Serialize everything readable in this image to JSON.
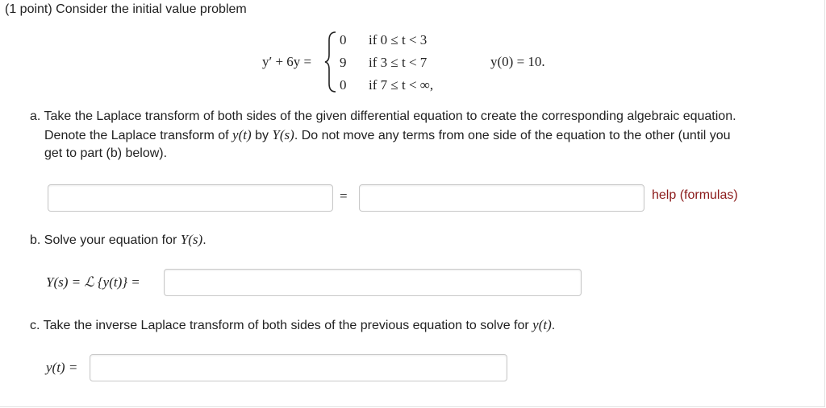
{
  "header": {
    "points": "(1 point)",
    "intro": "Consider the initial value problem"
  },
  "equation": {
    "lhs": "y′ + 6y =",
    "cases": [
      {
        "value": "0",
        "condition": "if 0 ≤ t < 3"
      },
      {
        "value": "9",
        "condition": "if 3 ≤ t < 7"
      },
      {
        "value": "0",
        "condition": "if 7 ≤ t < ∞,"
      }
    ],
    "initial_condition": "y(0) = 10."
  },
  "part_a": {
    "line1": "a. Take the Laplace transform of both sides of the given differential equation to create the corresponding algebraic equation.",
    "line2_pre": "Denote the Laplace transform of ",
    "line2_y": "y(t)",
    "line2_mid": " by ",
    "line2_Y": "Y(s)",
    "line2_post": ". Do not move any terms from one side of the equation to the other (until you",
    "line3": "get to part (b) below).",
    "equals": "=",
    "lhs_value": "",
    "rhs_value": "",
    "help_label": "help (formulas)"
  },
  "part_b": {
    "prompt_pre": "b. Solve your equation for ",
    "prompt_math": "Y(s)",
    "prompt_post": ".",
    "label": "Y(s) = ℒ {y(t)} =",
    "answer_value": ""
  },
  "part_c": {
    "prompt_pre": "c. Take the inverse Laplace transform of both sides of the previous equation to solve for ",
    "prompt_math": "y(t)",
    "prompt_post": ".",
    "label": "y(t) =",
    "answer_value": ""
  },
  "colors": {
    "help_link": "#8b1a1a",
    "input_border": "#c9c9c9"
  }
}
